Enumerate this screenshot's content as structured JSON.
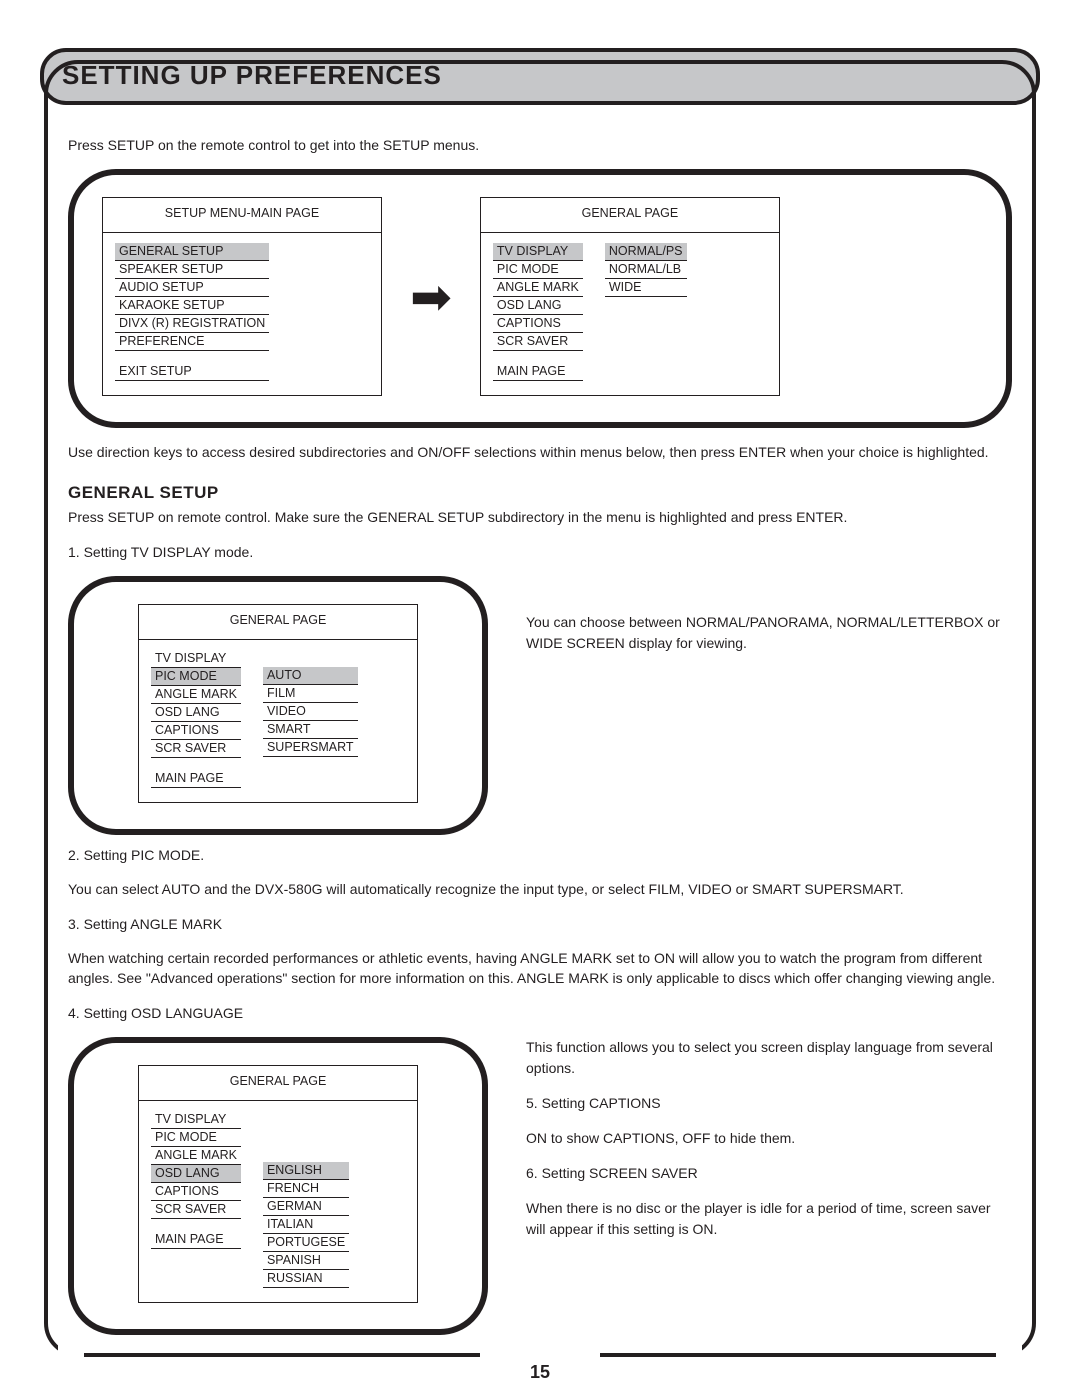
{
  "header": {
    "title": "Setting Up Preferences"
  },
  "intro": "Press SETUP on the remote control to get into the SETUP menus.",
  "diagram1": {
    "left": {
      "title": "SETUP MENU-MAIN PAGE",
      "items": [
        "GENERAL SETUP",
        "SPEAKER SETUP",
        "AUDIO SETUP",
        "KARAOKE SETUP",
        "DIVX (R) REGISTRATION",
        "PREFERENCE"
      ],
      "items_hl": [
        0
      ],
      "footer": "EXIT SETUP"
    },
    "right": {
      "title": "GENERAL PAGE",
      "left_col": [
        "TV DISPLAY",
        "PIC MODE",
        "ANGLE MARK",
        "OSD LANG",
        "CAPTIONS",
        "SCR SAVER"
      ],
      "left_hl": [
        0
      ],
      "right_col": [
        "NORMAL/PS",
        "NORMAL/LB",
        "WIDE"
      ],
      "right_hl": [
        0
      ],
      "footer": "MAIN PAGE"
    }
  },
  "after_diagram": "Use direction keys to access desired subdirectories and ON/OFF selections within menus below, then press ENTER when your choice is highlighted.",
  "general": {
    "heading": "General Setup",
    "intro": "Press SETUP on remote control.  Make sure the GENERAL SETUP subdirectory in the menu is highlighted and press ENTER.",
    "step1_label": "1. Setting TV DISPLAY mode.",
    "picmode": {
      "title": "GENERAL PAGE",
      "left_col": [
        "TV DISPLAY",
        "PIC MODE",
        "ANGLE MARK",
        "OSD LANG",
        "CAPTIONS",
        "SCR SAVER"
      ],
      "left_hl": [
        1
      ],
      "right_col": [
        "AUTO",
        "FILM",
        "VIDEO",
        "SMART",
        "SUPERSMART"
      ],
      "right_hl": [
        0
      ],
      "footer": "MAIN PAGE"
    },
    "step1_explain": "You can choose between NORMAL/PANORAMA, NORMAL/LETTERBOX or WIDE SCREEN display for viewing.",
    "step2_label": "2. Setting PIC MODE.",
    "step2_body": "You can select AUTO and the DVX-580G will automatically recognize the input type, or select FILM, VIDEO or SMART SUPERSMART.",
    "step3_label": "3. Setting ANGLE MARK",
    "step3_body": "When watching certain recorded performances or athletic events, having ANGLE MARK set to ON will allow you to watch the program from different angles.  See \"Advanced operations\" section for more information on this.  ANGLE MARK is only applicable to discs which offer changing viewing angle.",
    "step4_label": "4. Setting OSD LANGUAGE",
    "osdlang": {
      "title": "GENERAL PAGE",
      "left_col": [
        "TV DISPLAY",
        "PIC MODE",
        "ANGLE MARK",
        "OSD LANG",
        "CAPTIONS",
        "SCR SAVER"
      ],
      "left_hl": [
        3
      ],
      "right_col": [
        "ENGLISH",
        "FRENCH",
        "GERMAN",
        "ITALIAN",
        "PORTUGESE",
        "SPANISH",
        "RUSSIAN"
      ],
      "right_hl": [
        0
      ],
      "footer": "MAIN PAGE"
    },
    "step4_explain1": "This function allows you to select you screen display language from several options.",
    "step5_label": "5. Setting CAPTIONS",
    "step5_body": "ON to show CAPTIONS, OFF to hide them.",
    "step6_label": "6. Setting SCREEN SAVER",
    "step6_body": "When there is no disc or the player is idle for a period of time, screen saver will appear if this setting is ON."
  },
  "page_number": "15"
}
